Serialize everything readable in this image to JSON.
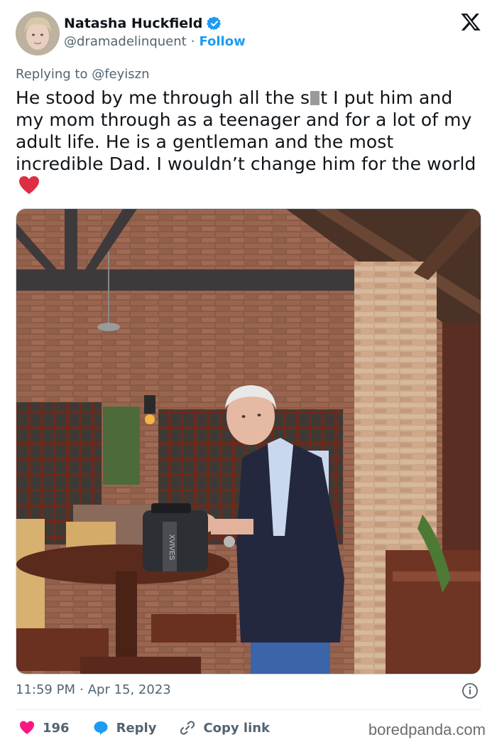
{
  "author": {
    "display_name": "Natasha Huckfield",
    "handle": "@dramadelinquent",
    "separator": "·",
    "follow_label": "Follow",
    "verified": true
  },
  "reply_context": {
    "prefix": "Replying to",
    "mention": "@feyiszn"
  },
  "tweet": {
    "text_part1": "He stood by me through all the s",
    "text_part2": "t I put him and my mom through as a teenager and for a lot of my adult life. He is a gentleman and the most incredible Dad. I wouldn’t change him for the world",
    "emoji": "red-heart"
  },
  "photo": {
    "bag_label": "XVIVES"
  },
  "meta": {
    "time": "11:59 PM",
    "separator": "·",
    "date": "Apr 15, 2023"
  },
  "actions": {
    "like_count": "196",
    "reply_label": "Reply",
    "copy_label": "Copy link"
  },
  "watermark": "boredpanda.com",
  "colors": {
    "accent": "#1d9bf0",
    "like": "#f91880",
    "muted": "#536471",
    "text": "#0f1419"
  },
  "icons": [
    "verified-badge-icon",
    "x-logo-icon",
    "heart-emoji-icon",
    "info-icon",
    "heart-icon",
    "reply-bubble-icon",
    "link-icon"
  ]
}
